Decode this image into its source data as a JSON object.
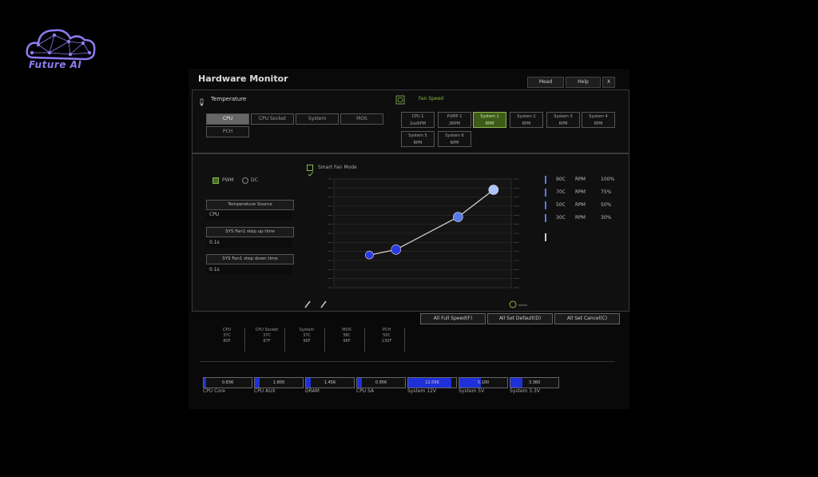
{
  "logo": {
    "text": "Future AI"
  },
  "window": {
    "title": "Hardware Monitor",
    "header_buttons": [
      "Mead",
      "Help",
      "X"
    ]
  },
  "temperature": {
    "section_label": "Temperature",
    "sources": [
      {
        "label": "CPU",
        "selected": true
      },
      {
        "label": "CPU Socket",
        "selected": false
      },
      {
        "label": "System",
        "selected": false
      },
      {
        "label": "MOS",
        "selected": false
      },
      {
        "label": "PCH",
        "selected": false
      }
    ]
  },
  "fan_speed": {
    "section_label": "Fan Speed",
    "fans": [
      {
        "name": "CPU 1",
        "value": "2xxRPM",
        "selected": false
      },
      {
        "name": "PUMP 1",
        "value": "2RPM",
        "selected": false
      },
      {
        "name": "System 1",
        "value": "RPM",
        "selected": true
      },
      {
        "name": "System 2",
        "value": "RPM",
        "selected": false
      },
      {
        "name": "System 3",
        "value": "RPM",
        "selected": false
      },
      {
        "name": "System 4",
        "value": "RPM",
        "selected": false
      },
      {
        "name": "System 5",
        "value": "RPM",
        "selected": false
      },
      {
        "name": "System 6",
        "value": "RPM",
        "selected": false
      }
    ]
  },
  "mode": {
    "pwm_label": "PWM",
    "dc_label": "DC",
    "smart_fan_label": "Smart Fan Mode"
  },
  "settings": [
    {
      "label": "Temperature Source",
      "value": "CPU"
    },
    {
      "label": "SYS Fan1 step up time",
      "value": "0.1s"
    },
    {
      "label": "SYS Fan1 step down time",
      "value": "0.1s"
    }
  ],
  "chart_data": {
    "type": "line",
    "title": "",
    "xlabel": "",
    "ylabel": "",
    "xlim": [
      0,
      100
    ],
    "ylim": [
      0,
      100
    ],
    "x": [
      20,
      35,
      70,
      90
    ],
    "series": [
      {
        "values": [
          30,
          35,
          65,
          90
        ]
      }
    ],
    "grid": true
  },
  "curve_points": [
    {
      "temp": "90C",
      "rpm": "RPM",
      "pct": "100%"
    },
    {
      "temp": "70C",
      "rpm": "RPM",
      "pct": "75%"
    },
    {
      "temp": "50C",
      "rpm": "RPM",
      "pct": "50%"
    },
    {
      "temp": "30C",
      "rpm": "RPM",
      "pct": "30%"
    }
  ],
  "buttons": {
    "full_speed": "All Full Speed(F)",
    "set_default": "All Set Default(D)",
    "set_cancel": "All Set Cancel(C)"
  },
  "temps": [
    {
      "name": "CPU",
      "line2": "37C",
      "line3": "80F"
    },
    {
      "name": "CPU Socket",
      "line2": "37C",
      "line3": "87F"
    },
    {
      "name": "System",
      "line2": "37C",
      "line3": "96F"
    },
    {
      "name": "MOS",
      "line2": "38C",
      "line3": "96F"
    },
    {
      "name": "PCH",
      "line2": "55C",
      "line3": "130F"
    }
  ],
  "voltages": [
    {
      "name": "CPU Core",
      "value": "0.836",
      "level": 0.05
    },
    {
      "name": "CPU AUX",
      "value": "1.800",
      "level": 0.1
    },
    {
      "name": "DRAM",
      "value": "1.456",
      "level": 0.1
    },
    {
      "name": "CPU SA",
      "value": "0.956",
      "level": 0.1
    },
    {
      "name": "System 12V",
      "value": "12.096",
      "level": 0.9
    },
    {
      "name": "System 5V",
      "value": "5.100",
      "level": 0.45
    },
    {
      "name": "System 3.3V",
      "value": "3.360",
      "level": 0.25
    }
  ],
  "colors": {
    "accent_green": "#8ab84a",
    "point_blue": "#2a3ae0",
    "point_lightblue": "#a8c4f8",
    "volt_blue": "#2030d8"
  }
}
